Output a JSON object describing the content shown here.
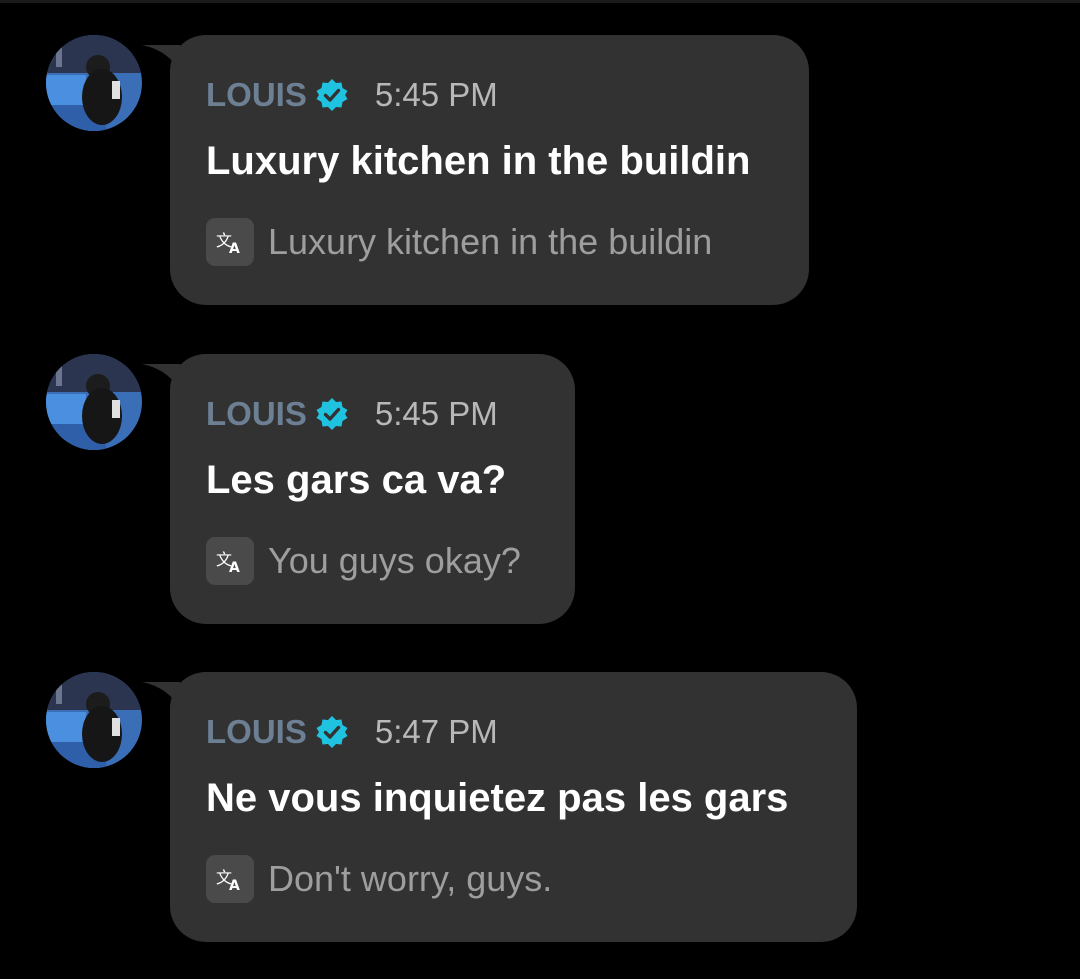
{
  "messages": [
    {
      "sender": "LOUIS",
      "time": "5:45 PM",
      "text": "Luxury kitchen in the buildin",
      "translation": "Luxury kitchen in the buildin",
      "avatar_icon": "avatar-icon",
      "verified_icon": "verified-badge-icon",
      "translate_icon": "translate-icon"
    },
    {
      "sender": "LOUIS",
      "time": "5:45 PM",
      "text": "Les gars ca va?",
      "translation": "You guys okay?",
      "avatar_icon": "avatar-icon",
      "verified_icon": "verified-badge-icon",
      "translate_icon": "translate-icon"
    },
    {
      "sender": "LOUIS",
      "time": "5:47 PM",
      "text": "Ne vous inquietez pas les gars",
      "translation": "Don't worry, guys.",
      "avatar_icon": "avatar-icon",
      "verified_icon": "verified-badge-icon",
      "translate_icon": "translate-icon"
    }
  ],
  "colors": {
    "background": "#000000",
    "bubble": "#323232",
    "sender": "#6c7f93",
    "verified_badge": "#1fc3e0",
    "message_text": "#ffffff",
    "translation_text": "#9e9e9e"
  }
}
